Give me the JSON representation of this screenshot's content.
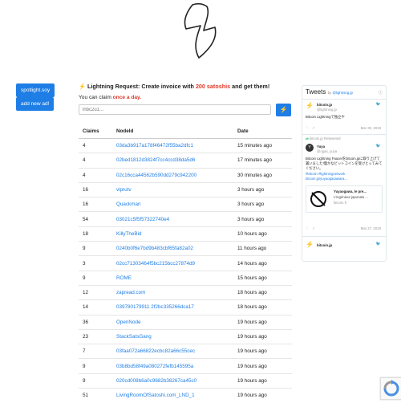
{
  "sidebar": {
    "spotlight_label": "spotlight.soy",
    "add_ad_label": "add new ad!"
  },
  "headline": {
    "prefix": " Lightning Request: Create invoice with ",
    "amount": "200 satoshis",
    "suffix": " and get them!"
  },
  "claim_note": {
    "prefix": "You can claim ",
    "emphasis": "once a day."
  },
  "invoice": {
    "placeholder": "lnbc2u1..."
  },
  "table": {
    "headers": [
      "Claims",
      "NodeId",
      "Date"
    ],
    "rows": [
      [
        "4",
        "03da3b917a178f46472f55ba2dfc1",
        "15 minutes ago"
      ],
      [
        "4",
        "02bed1812d3824f7cc4ccd38da5d6",
        "17 minutes ago"
      ],
      [
        "4",
        "02c16cca44562b590dd279c942200",
        "30 minutes ago"
      ],
      [
        "16",
        "viprutv",
        "3 hours ago"
      ],
      [
        "16",
        "Quackman",
        "3 hours ago"
      ],
      [
        "54",
        "03021c5f5f57322740e4",
        "3 hours ago"
      ],
      [
        "18",
        "KillyTheBid",
        "10 hours ago"
      ],
      [
        "9",
        "0240b0f6e7bd9b483cbf65fa82a02",
        "11 hours ago"
      ],
      [
        "3",
        "02cc71303464f5bc215bcc27874d9",
        "14 hours ago"
      ],
      [
        "9",
        "ROME",
        "15 hours ago"
      ],
      [
        "12",
        "zapread.com",
        "18 hours ago"
      ],
      [
        "14",
        "039780179911 2f2bc335266dca17",
        "18 hours ago"
      ],
      [
        "36",
        "OpenNode",
        "19 hours ago"
      ],
      [
        "23",
        "StackSatsGang",
        "19 hours ago"
      ],
      [
        "7",
        "03faa072a66822ecbc82a66c55cec",
        "19 hours ago"
      ],
      [
        "9",
        "03b8bd58f49a080272fefb145595a",
        "19 hours ago"
      ],
      [
        "9",
        "020cd008b6a0c9682b38267ca45c0",
        "19 hours ago"
      ],
      [
        "51",
        "LivingRoomOfSatoshi.com_LND_1",
        "19 hours ago"
      ]
    ]
  },
  "twitter": {
    "title": "Tweets",
    "by_prefix": "by ",
    "by_handle": "@lightning.jp",
    "tweet1": {
      "name": "bitcoin.jp",
      "handle": "@lightning.jp",
      "text": "Bitcoin Lightningで独立や",
      "date": "Mar 30, 2019"
    },
    "retweet_label": "bitcoin.jp Retweeted",
    "tweet2": {
      "name": "Yuya",
      "handle": "@ogas_yuya",
      "text": "Bitcoin Lightning Faucetをbitcoin.jpに取り上げて貰いました!僅かなビットコインを受けとってみてください。",
      "hashtags": "#bitcoin #lightningnetwork bitcoin.jp/yuyaogasawara...",
      "card_title": "Yuyaogawa, le pre...",
      "card_desc": "L'ingénieur japonais ...",
      "card_domain": "bitcoin.fr",
      "date": "Mar 27, 2019"
    },
    "tweet3": {
      "name": "bitcoin.jp"
    },
    "colors": {
      "accent": "#1e7ee6",
      "bolt": "#f7c600"
    }
  },
  "colors": {
    "primary": "#1e7ee6",
    "emphasis": "#e03a2a"
  }
}
